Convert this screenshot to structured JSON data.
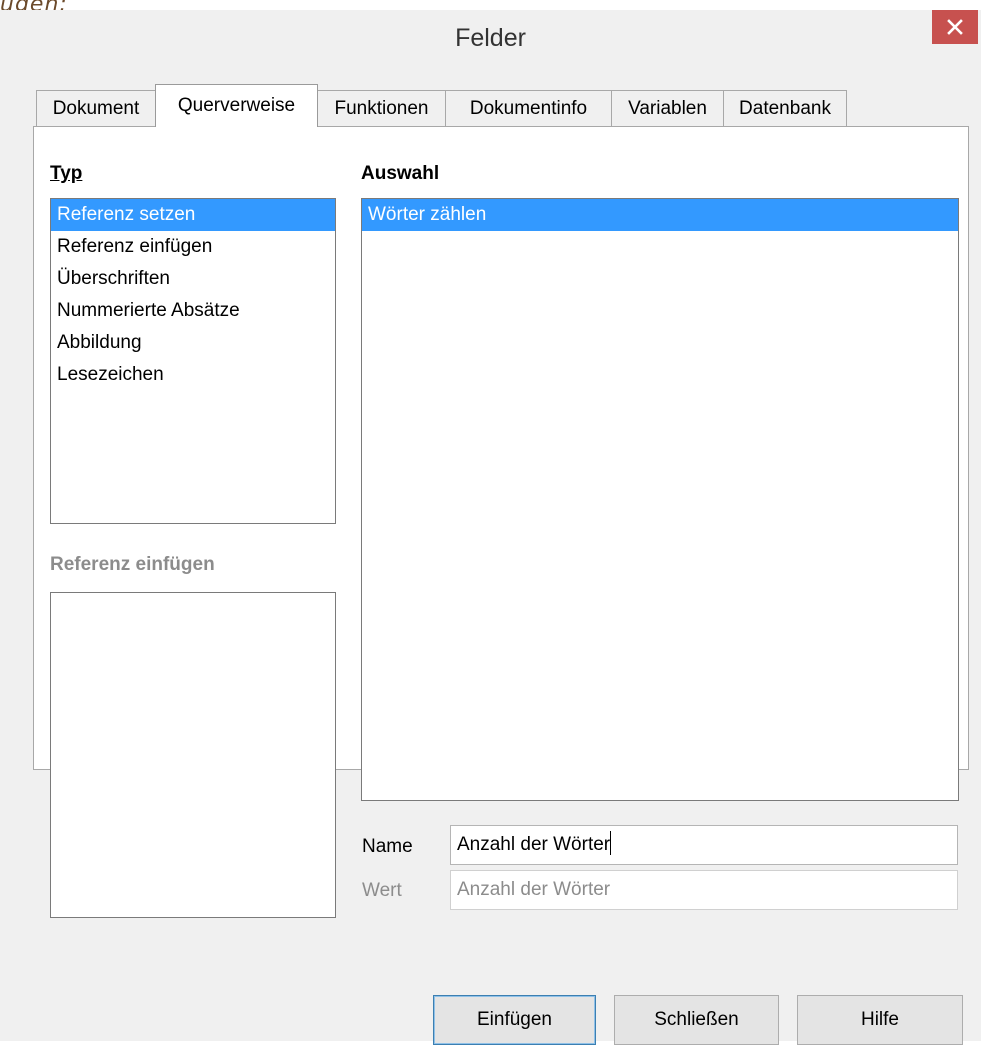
{
  "top_fragment": "ugen:",
  "dialog": {
    "title": "Felder"
  },
  "tabs": [
    {
      "label": "Dokument",
      "active": false
    },
    {
      "label": "Querverweise",
      "active": true
    },
    {
      "label": "Funktionen",
      "active": false
    },
    {
      "label": "Dokumentinfo",
      "active": false
    },
    {
      "label": "Variablen",
      "active": false
    },
    {
      "label": "Datenbank",
      "active": false
    }
  ],
  "type_section": {
    "label": "Typ",
    "items": [
      "Referenz setzen",
      "Referenz einfügen",
      "Überschriften",
      "Nummerierte Absätze",
      "Abbildung",
      "Lesezeichen"
    ],
    "selected": "Referenz setzen"
  },
  "insert_reference_section": {
    "label": "Referenz einfügen"
  },
  "selection_section": {
    "label": "Auswahl",
    "items": [
      "Wörter zählen"
    ],
    "selected": "Wörter zählen"
  },
  "name_field": {
    "label": "Name",
    "value": "Anzahl der Wörter"
  },
  "value_field": {
    "label": "Wert",
    "value": "Anzahl der Wörter"
  },
  "buttons": {
    "insert": "Einfügen",
    "close": "Schließen",
    "help": "Hilfe"
  },
  "colors": {
    "selection": "#3399ff",
    "close_button": "#c7514f",
    "dialog_bg": "#f0f0f0"
  },
  "icons": {
    "close": "close-icon"
  }
}
